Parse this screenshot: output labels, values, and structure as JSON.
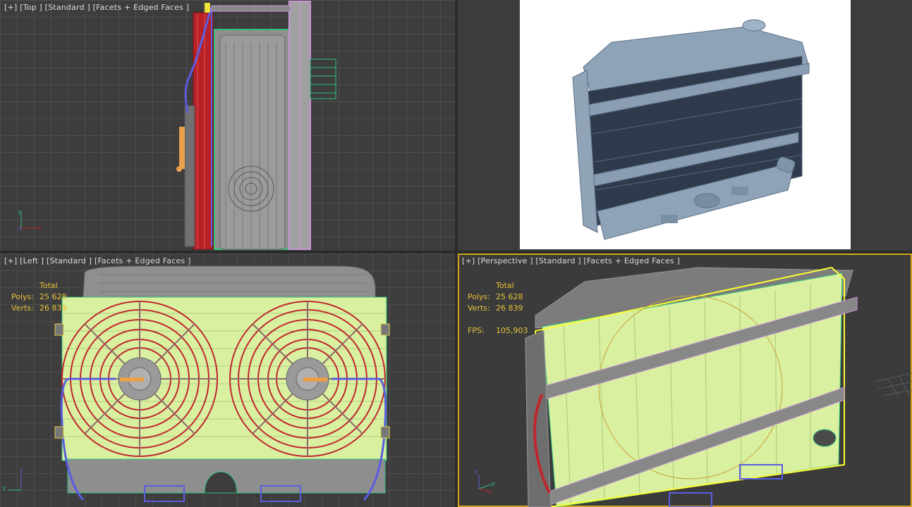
{
  "viewports": {
    "top": {
      "label": "[+] [Top ] [Standard ] [Facets + Edged Faces ]"
    },
    "render": {},
    "left": {
      "label": "[+] [Left ] [Standard ] [Facets + Edged Faces ]",
      "stats": {
        "header": "Total",
        "polys_label": "Polys:",
        "polys": "25 628",
        "verts_label": "Verts:",
        "verts": "26 839"
      }
    },
    "perspective": {
      "label": "[+] [Perspective ] [Standard ] [Facets + Edged Faces ]",
      "stats": {
        "header": "Total",
        "polys_label": "Polys:",
        "polys": "25 628",
        "verts_label": "Verts:",
        "verts": "26 839",
        "fps_label": "FPS:",
        "fps": "105,903"
      },
      "active": true
    }
  },
  "axis_labels": {
    "x": "x",
    "y": "y",
    "z": "z"
  },
  "colors": {
    "active_border": "#d4a61c",
    "wire_green": "#2fc37c",
    "wire_red": "#c0272d",
    "wire_blue": "#5a5de0",
    "wire_pink": "#c995d6",
    "face_yellow_green": "#d9f0a0",
    "selection_yellow": "#ffff33",
    "stats_text": "#e6c23a"
  }
}
